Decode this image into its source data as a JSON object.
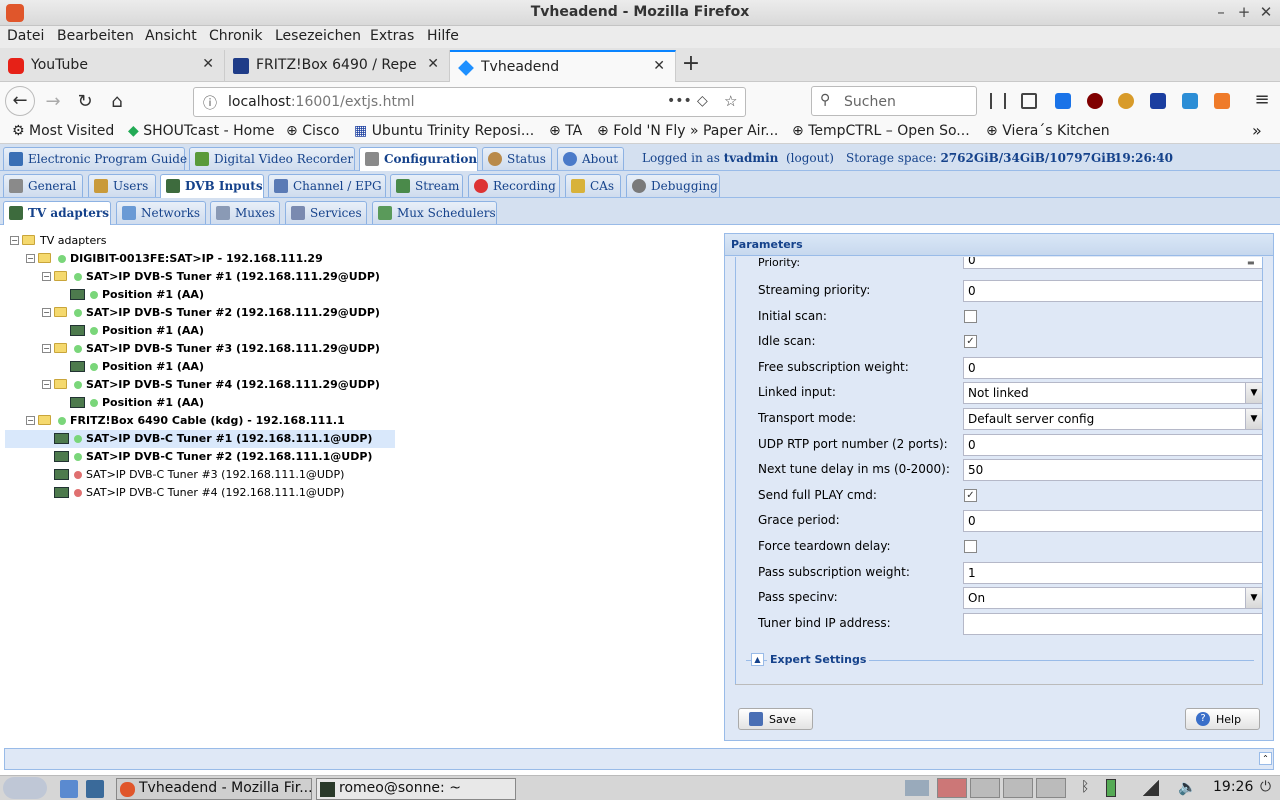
{
  "window": {
    "title": "Tvheadend - Mozilla Firefox"
  },
  "menu": [
    "Datei",
    "Bearbeiten",
    "Ansicht",
    "Chronik",
    "Lesezeichen",
    "Extras",
    "Hilfe"
  ],
  "tabs": [
    {
      "label": "YouTube",
      "icon": "youtube-icon",
      "color": "#e62117"
    },
    {
      "label": "FRITZ!Box 6490 / Repeat",
      "icon": "fritzbox-icon",
      "color": "#1f3c88"
    },
    {
      "label": "Tvheadend",
      "icon": "tvheadend-icon",
      "color": "#1e90ff"
    }
  ],
  "url": {
    "host": "localhost",
    "rest": ":16001/extjs.html"
  },
  "search": {
    "placeholder": "Suchen"
  },
  "bookmarks": [
    "Most Visited",
    "SHOUTcast - Home",
    "Cisco",
    "Ubuntu Trinity Reposi...",
    "TA",
    "Fold 'N Fly » Paper Air...",
    "TempCTRL – Open So...",
    "Viera´s Kitchen"
  ],
  "tvh": {
    "top_tabs": [
      "Electronic Program Guide",
      "Digital Video Recorder",
      "Configuration",
      "Status",
      "About"
    ],
    "login": {
      "prefix": "Logged in as",
      "user": "tvadmin",
      "logout": "(logout)",
      "storage_label": "Storage space:",
      "storage_value": "2762GiB/34GiB/10797GiB",
      "time": "19:26:40"
    },
    "config_tabs": [
      "General",
      "Users",
      "DVB Inputs",
      "Channel / EPG",
      "Stream",
      "Recording",
      "CAs",
      "Debugging"
    ],
    "dvb_tabs": [
      "TV adapters",
      "Networks",
      "Muxes",
      "Services",
      "Mux Schedulers"
    ]
  },
  "tree": {
    "root": "TV adapters",
    "items": [
      {
        "label": "DIGIBIT-0013FE:SAT>IP - 192.168.111.29",
        "level": 1,
        "bold": true,
        "status": "green",
        "kind": "folder"
      },
      {
        "label": "SAT>IP DVB-S Tuner #1 (192.168.111.29@UDP)",
        "level": 2,
        "bold": true,
        "status": "green",
        "kind": "folder"
      },
      {
        "label": "Position #1 (AA)",
        "level": 3,
        "bold": true,
        "status": "green",
        "kind": "card"
      },
      {
        "label": "SAT>IP DVB-S Tuner #2 (192.168.111.29@UDP)",
        "level": 2,
        "bold": true,
        "status": "green",
        "kind": "folder"
      },
      {
        "label": "Position #1 (AA)",
        "level": 3,
        "bold": true,
        "status": "green",
        "kind": "card"
      },
      {
        "label": "SAT>IP DVB-S Tuner #3 (192.168.111.29@UDP)",
        "level": 2,
        "bold": true,
        "status": "green",
        "kind": "folder"
      },
      {
        "label": "Position #1 (AA)",
        "level": 3,
        "bold": true,
        "status": "green",
        "kind": "card"
      },
      {
        "label": "SAT>IP DVB-S Tuner #4 (192.168.111.29@UDP)",
        "level": 2,
        "bold": true,
        "status": "green",
        "kind": "folder"
      },
      {
        "label": "Position #1 (AA)",
        "level": 3,
        "bold": true,
        "status": "green",
        "kind": "card"
      },
      {
        "label": "FRITZ!Box 6490 Cable (kdg) - 192.168.111.1",
        "level": 1,
        "bold": true,
        "status": "green",
        "kind": "folder"
      },
      {
        "label": "SAT>IP DVB-C Tuner #1 (192.168.111.1@UDP)",
        "level": 2,
        "bold": true,
        "status": "green",
        "kind": "card",
        "selected": true
      },
      {
        "label": "SAT>IP DVB-C Tuner #2 (192.168.111.1@UDP)",
        "level": 2,
        "bold": true,
        "status": "green",
        "kind": "card"
      },
      {
        "label": "SAT>IP DVB-C Tuner #3 (192.168.111.1@UDP)",
        "level": 2,
        "bold": false,
        "status": "red",
        "kind": "card"
      },
      {
        "label": "SAT>IP DVB-C Tuner #4 (192.168.111.1@UDP)",
        "level": 2,
        "bold": false,
        "status": "red",
        "kind": "card"
      }
    ]
  },
  "params": {
    "title": "Parameters",
    "partial_label": "Priority:",
    "partial_value": "0",
    "fields": [
      {
        "label": "Streaming priority:",
        "type": "text",
        "value": "0"
      },
      {
        "label": "Initial scan:",
        "type": "check",
        "checked": false
      },
      {
        "label": "Idle scan:",
        "type": "check",
        "checked": true
      },
      {
        "label": "Free subscription weight:",
        "type": "text",
        "value": "0"
      },
      {
        "label": "Linked input:",
        "type": "select",
        "value": "Not linked"
      },
      {
        "label": "Transport mode:",
        "type": "select",
        "value": "Default server config"
      },
      {
        "label": "UDP RTP port number (2 ports):",
        "type": "text",
        "value": "0"
      },
      {
        "label": "Next tune delay in ms (0-2000):",
        "type": "text",
        "value": "50"
      },
      {
        "label": "Send full PLAY cmd:",
        "type": "check",
        "checked": true
      },
      {
        "label": "Grace period:",
        "type": "text",
        "value": "0"
      },
      {
        "label": "Force teardown delay:",
        "type": "check",
        "checked": false
      },
      {
        "label": "Pass subscription weight:",
        "type": "text",
        "value": "1"
      },
      {
        "label": "Pass specinv:",
        "type": "select",
        "value": "On"
      },
      {
        "label": "Tuner bind IP address:",
        "type": "text",
        "value": ""
      }
    ],
    "expert": "Expert Settings",
    "save": "Save",
    "help": "Help"
  },
  "taskbar": {
    "tasks": [
      "Tvheadend - Mozilla Fir...",
      "romeo@sonne: ~"
    ],
    "clock": "19:26"
  }
}
